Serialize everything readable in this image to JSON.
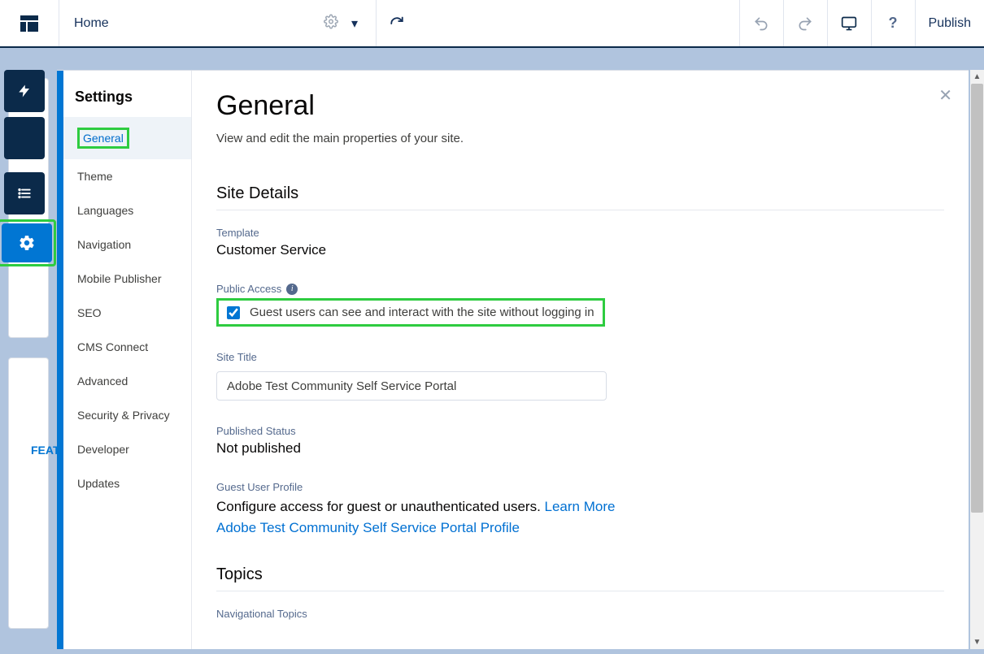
{
  "topbar": {
    "title": "Home",
    "publish_label": "Publish"
  },
  "rail": {
    "items": [
      "bolt",
      "brush",
      "list",
      "gear"
    ]
  },
  "sidebar": {
    "heading": "Settings",
    "items": [
      {
        "label": "General",
        "active": true,
        "highlighted": true
      },
      {
        "label": "Theme"
      },
      {
        "label": "Languages"
      },
      {
        "label": "Navigation"
      },
      {
        "label": "Mobile Publisher"
      },
      {
        "label": "SEO"
      },
      {
        "label": "CMS Connect"
      },
      {
        "label": "Advanced"
      },
      {
        "label": "Security & Privacy"
      },
      {
        "label": "Developer"
      },
      {
        "label": "Updates"
      }
    ]
  },
  "main": {
    "title": "General",
    "subtitle": "View and edit the main properties of your site.",
    "sections": {
      "site_details": {
        "heading": "Site Details",
        "template_label": "Template",
        "template_value": "Customer Service",
        "public_access_label": "Public Access",
        "public_access_checkbox": "Guest users can see and interact with the site without logging in",
        "public_access_checked": true,
        "site_title_label": "Site Title",
        "site_title_value": "Adobe Test Community Self Service Portal",
        "published_status_label": "Published Status",
        "published_status_value": "Not published",
        "guest_profile_label": "Guest User Profile",
        "guest_profile_desc": "Configure access for guest or unauthenticated users. ",
        "guest_profile_learn_more": "Learn More",
        "guest_profile_link": "Adobe Test Community Self Service Portal Profile"
      },
      "topics": {
        "heading": "Topics",
        "nav_topics_label": "Navigational Topics"
      }
    }
  },
  "bg": {
    "tab_text": "FEAT"
  }
}
